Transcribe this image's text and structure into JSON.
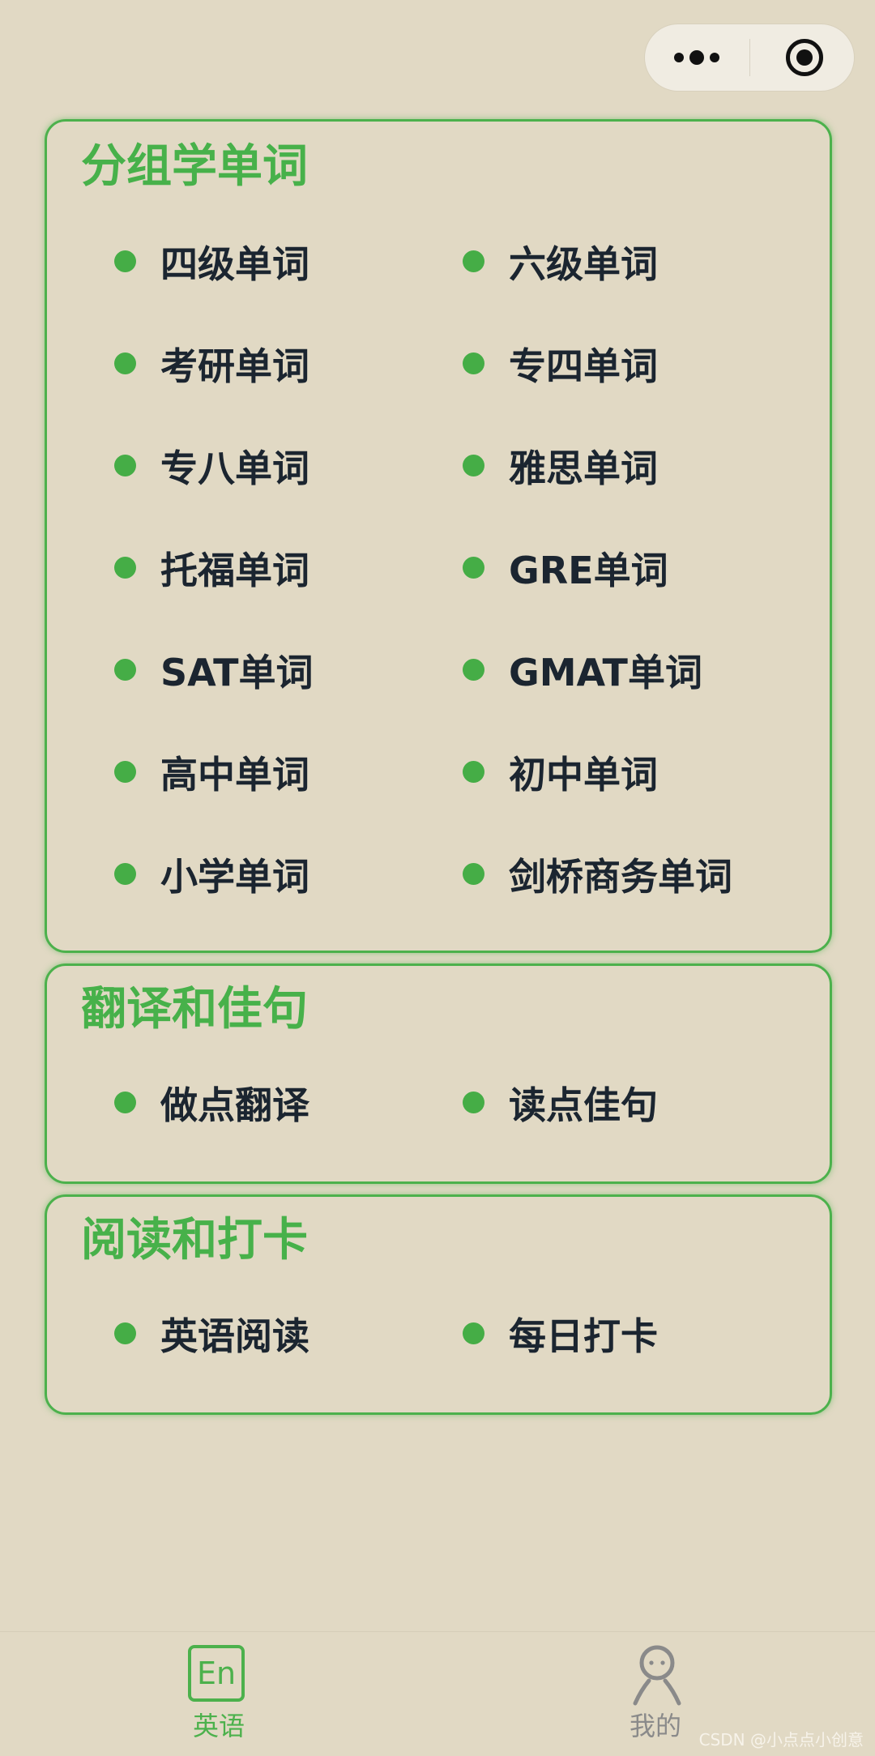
{
  "capsule": {
    "more_icon": "more-dots-icon",
    "close_icon": "target-close-icon"
  },
  "sections": [
    {
      "title": "分组学单词",
      "items": [
        "四级单词",
        "六级单词",
        "考研单词",
        "专四单词",
        "专八单词",
        "雅思单词",
        "托福单词",
        "GRE单词",
        "SAT单词",
        "GMAT单词",
        "高中单词",
        "初中单词",
        "小学单词",
        "剑桥商务单词"
      ]
    },
    {
      "title": "翻译和佳句",
      "items": [
        "做点翻译",
        "读点佳句"
      ]
    },
    {
      "title": "阅读和打卡",
      "items": [
        "英语阅读",
        "每日打卡"
      ]
    }
  ],
  "tabbar": {
    "tabs": [
      {
        "label": "英语",
        "icon_text": "En",
        "icon": "en-book-icon",
        "active": true
      },
      {
        "label": "我的",
        "icon": "person-icon",
        "active": false
      }
    ],
    "active_color": "#4cb14c",
    "inactive_color": "#8a8a8a"
  },
  "watermark": "CSDN @小点点小创意",
  "colors": {
    "background": "#e1d9c4",
    "accent": "#47b14a",
    "text": "#1b2530"
  }
}
